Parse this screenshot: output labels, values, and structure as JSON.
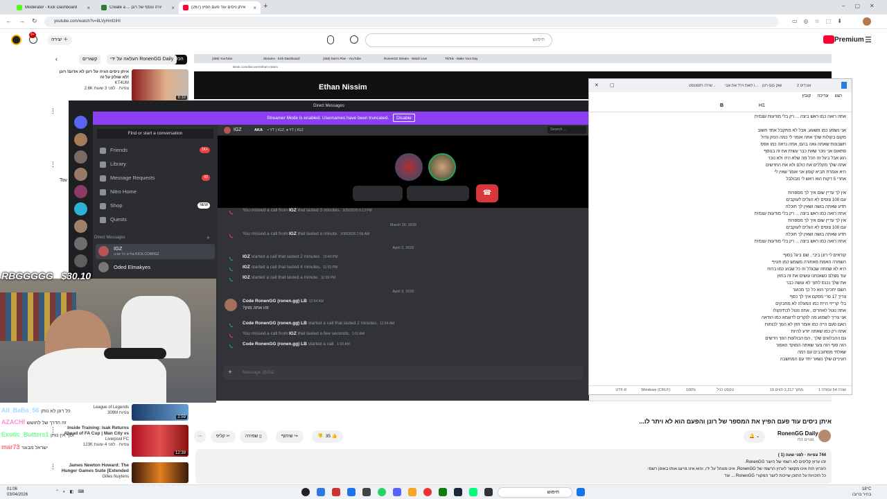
{
  "browser": {
    "tabs": [
      {
        "title": "Moderator - Kick Dashboard",
        "color": "#53fc18"
      },
      {
        "title": "Create a ... יורה ונוסף של רונן",
        "color": "#2e7d32"
      },
      {
        "title": "(267) איתן ניסים עוד פעם הפיץ",
        "color": "#ff0033"
      }
    ],
    "url": "youtube.com/watch?v=8LVyHmfziHI",
    "new_tab": "+"
  },
  "youtube": {
    "create_label": "יצירה",
    "search_placeholder": "חיפוש",
    "premium_label": "Premium",
    "notif_count": "9+",
    "chips": [
      "הכל",
      "העלאה על ידי RonenGG Daily",
      "קשורים"
    ]
  },
  "recs": [
    {
      "title": "איתן ניסים הגיה על רונן לא אדום! רונן לא שולק על זה!",
      "channel": "KT4UM",
      "meta": "2.6K צפיות · לפני 3 שעות",
      "dur": "8:33"
    },
    {
      "title": "Inside Training: Isak Returns Ahead of FA Cup | Man City vs",
      "channel": "Liverpool FC",
      "meta": "123K צפיות · לפני 4 שעות",
      "dur": "12:39"
    },
    {
      "title": "James Newton Howard: The Hunger Games Suite [Extended",
      "channel": "Gilles Nuytens",
      "meta": "",
      "dur": ""
    }
  ],
  "lol": {
    "channel": "League of Legends",
    "meta": "309M צפיות",
    "dur": "2:59"
  },
  "inner_browser": {
    "header_name": "Ethan Nissim",
    "tabs": [
      "(258) YouTube",
      "Streams - Kick Dashboard",
      "(258) Dan's Plan - YouTube",
      "RonenGG Stream - Watch Live",
      "TikTok - Make Your Day"
    ],
    "url": "tiktok.com/discover/ethan-nissim"
  },
  "discord": {
    "title": "Direct Messages",
    "banner": "Streamer Mode is enabled. Usernames have been truncated.",
    "banner_btn": "Disable",
    "search_conv": "Find or start a conversation",
    "nav": [
      {
        "label": "Friends",
        "badge": "1K+"
      },
      {
        "label": "Library",
        "badge": ""
      },
      {
        "label": "Message Requests",
        "badge": "82"
      },
      {
        "label": "Nitro Home",
        "badge": ""
      },
      {
        "label": "Shop",
        "badge": "NEW"
      },
      {
        "label": "Quests",
        "badge": ""
      }
    ],
    "dm_header": "Direct Messages",
    "dms": [
      {
        "name": "IGZ",
        "sub": "גולייב כל יום ב KICK.COM/IGZ"
      },
      {
        "name": "Oded Elmakyes",
        "sub": ""
      }
    ],
    "chat_user": "IGZ",
    "chat_aka": "AKA",
    "chat_aka_names": "• YT | IGZ, ♦ YT | IGZ",
    "chat_search": "Search ...",
    "messages": [
      {
        "kind": "call",
        "missed": true,
        "text_a": "You missed a call from",
        "user": "IGZ",
        "text_b": "that lasted 3 minutes.",
        "time": "3/26/2026 6:13 PM"
      },
      {
        "kind": "date",
        "text": "March 30, 2026"
      },
      {
        "kind": "call",
        "missed": true,
        "text_a": "You missed a call from",
        "user": "IGZ",
        "text_b": "that lasted a minute.",
        "time": "3/30/2026 2:56 AM"
      },
      {
        "kind": "date",
        "text": "April 2, 2026"
      },
      {
        "kind": "call",
        "missed": false,
        "text_a": "",
        "user": "IGZ",
        "text_b": "started a call that lasted 2 minutes.",
        "time": "10:40 PM"
      },
      {
        "kind": "call",
        "missed": false,
        "text_a": "",
        "user": "IGZ",
        "text_b": "started a call that lasted 4 minutes.",
        "time": "11:53 PM"
      },
      {
        "kind": "call",
        "missed": false,
        "text_a": "",
        "user": "IGZ",
        "text_b": "started a call that lasted a minute.",
        "time": "11:59 PM"
      },
      {
        "kind": "date",
        "text": "April 3, 2026"
      },
      {
        "kind": "text",
        "user": "Code RonenGG (ronen.gg) LB",
        "time": "12:54 AM",
        "body": "?זהו אתה מוק"
      },
      {
        "kind": "call",
        "missed": false,
        "text_a": "",
        "user": "Code RonenGG (ronen.gg) LB",
        "text_b": "started a call that lasted 2 minutes.",
        "time": "12:54 AM"
      },
      {
        "kind": "call",
        "missed": true,
        "text_a": "You missed a call from",
        "user": "IGZ",
        "text_b": "that lasted a few seconds.",
        "time": "1:01 AM"
      },
      {
        "kind": "call",
        "missed": false,
        "text_a": "",
        "user": "Code RonenGG (ronen.gg) LB",
        "text_b": "started a call.",
        "time": "1:03 AM"
      }
    ],
    "composer": "Message @IGZ"
  },
  "notepad": {
    "tabs": [
      "שירה רפמונסט ..",
      "כיפו לואת וירד את אבי",
      "רונן GG שוק",
      "דיט 2.txt"
    ],
    "menu": [
      "קובץ",
      "עריכה",
      "הצג"
    ],
    "heading": "H1",
    "lines": [
      "אתה רואה כמו ראש ביצה ... רק בלי מודעות עצמית",
      "",
      "אני נשמע כמו משוגע, אבל לא מתקבל אחד חשוב",
      "מקום בקולות שלך אתה אומר לי כמה הנזק גדול",
      "חשבונות שאתה גאה בהם, אתה נראה כמו אפס",
      "פתאום אני נזכר שאת כבר עשית את זה בנוסף",
      "רגע אבל ביגל זה הכל מה שלא היה ולא נוכר",
      "אתה שלך מקללים את כולם ולא את החדשים",
      "היא אומרת תביא קופון אני אומר שאין לי",
      "אחרי 5 דקות הוא ראש לי מבולבל",
      "",
      "אין לך עדיין שום איך לך מספרות",
      "עם 100 צופים לא הגלים לעוקבים",
      "תדע שאתה בושה ושאין לך חוכלה",
      "אתה רואה כמו ראש ביצה ... רק בלי מודעות עצמית",
      "אין לך עדיין שום איך לך מספרות",
      "עם 100 צופים לא הגלים לעוקבים",
      "תדע שאתה בושה ושאין לך חוכלה",
      "אתה רואה כמו ראש ביצה ... רק בלי מודעות עצמית",
      "",
      "קוראים לי רונן ביבי , שם ביגל בסוף",
      "השחרה האמת מאחורה משמש כמו חטיף",
      "היא לא שמחה שבגלל זה כל שבוע כמו ברוח",
      "עוד מצלם כשאנחנו עושים את זה בחוץ",
      "את שלך נכנס לתוך לא עושה כבר",
      "השם יחכינך הוא כל כך מכוער",
      "צריך 17 פרי מסקם איך לך כסף",
      "בלי קרייזי היית כמו המעלה לא מחבקים",
      "אתה נוטל לאחרים , אתה נוטל לכתינקולו",
      "אני צריך לשמוע מה לנקרים לדוגמא כמו הודאה",
      "האם פעם הייה כמו אומר חוץ לא הפך לכוחות",
      "אתה רק כמו שאתה יודע להיות",
      "גם ההבלוגים שלך , הם הבולעות הפך הדשים",
      "הזה סוף הזה צער שאתה המוקד האפור",
      "שאלתי מסתובבים עם רמה",
      "העיניים שלך נשאר יחד עם המחשבה"
    ],
    "status": [
      "שורה 54 עמודה 1",
      "19 מתוך 2,217 תווים",
      "טקסט רגיל",
      "100%",
      "Windows (CRLF)",
      "UTF-8"
    ]
  },
  "chat_overlay": [
    {
      "name": "RBGGGGG",
      "text": "$30.10",
      "color": "#ffffff"
    },
    {
      "name": "All_BaBa_56",
      "text": "כל רונן לא נותן",
      "color": "#a8d8ff"
    },
    {
      "name": "AZACHI",
      "text": "זה הדרך של לחושש",
      "color": "#ff8ad8"
    },
    {
      "name": "Exotic_Butters1",
      "text": "וסף אין נותן",
      "color": "#6bff8a"
    },
    {
      "name": "mar73",
      "text": "ישראל מבוגר",
      "color": "#ff6b6b"
    }
  ],
  "video": {
    "title": "איתן ניסים עוד פעם הפיץ את המספר של רונן והפעם הוא לא ויתר לו...",
    "channel": "RonenGG Daily",
    "subs": "701 מנויים",
    "likes": "35",
    "share": "שיתוף",
    "save": "שמירה",
    "clip": "קליפ",
    "views": "744 צפיות · לפני שעה (1 )",
    "desc1": "זהו ערוץ קליפים לא רשמי של היוצר RonenGG.",
    "desc2": "הערוץ הזה אינו מקושר לערוץ הרשמי של RonenGG, אינו מנוהל על ידו, והוא אינו מייצג אותו באופן רשמי.",
    "desc3": "כל הזכויות על התוכן שייכות ליוצר המקורי RonenGG ... עוד"
  },
  "taskbar": {
    "time": "01:06",
    "date": "03/04/2026",
    "search": "חיפוש",
    "weather_temp": "18°C",
    "weather": "בהיר ברובו",
    "lang": "ENG"
  }
}
